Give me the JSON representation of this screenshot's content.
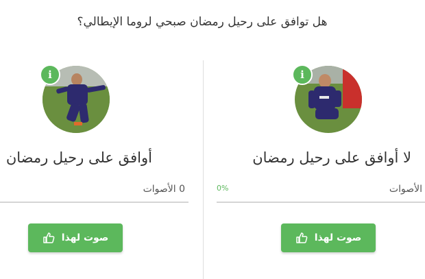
{
  "poll": {
    "question": "هل توافق على رحيل رمضان صبحي لروما الإيطالي؟"
  },
  "options": [
    {
      "label": "أوافق على رحيل رمضان",
      "votes_text": "0 الأصوات",
      "percent": "",
      "button_label": "صوت لهذا",
      "info_icon": "info-icon",
      "button_icon": "thumbs-up-icon"
    },
    {
      "label": "لا أوافق على رحيل رمضان",
      "votes_text": "الأصوات",
      "percent": "0%",
      "button_label": "صوت لهذا",
      "info_icon": "info-icon",
      "button_icon": "thumbs-up-icon"
    }
  ],
  "colors": {
    "accent_green": "#5cb85c",
    "text": "#333333",
    "divider": "#dddddd"
  }
}
